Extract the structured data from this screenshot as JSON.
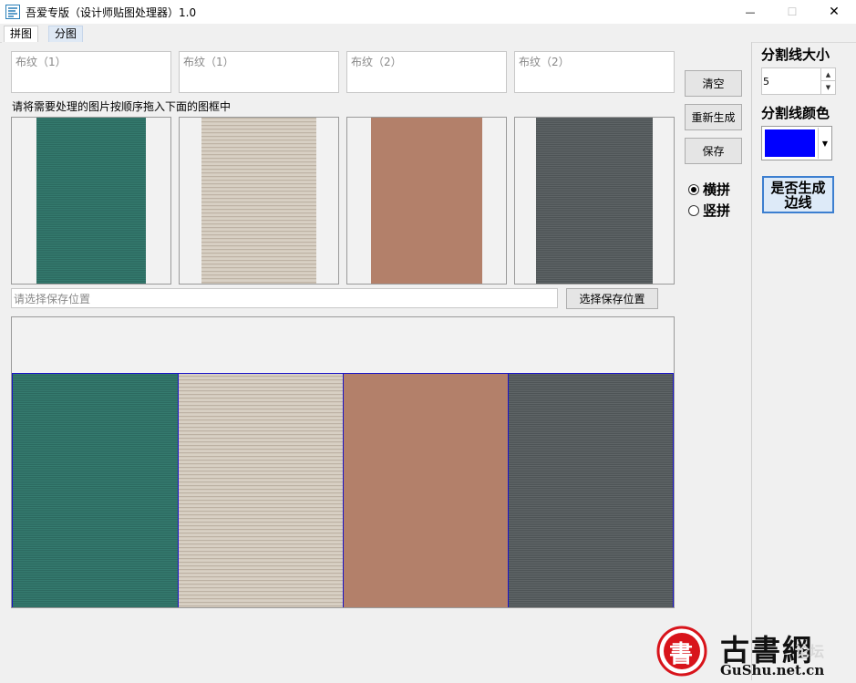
{
  "window": {
    "title": "吾爱专版（设计师贴图处理器）1.0",
    "minimize_glyph": "—",
    "maximize_glyph": "☐",
    "close_glyph": "✕"
  },
  "tabs": [
    {
      "label": "拼图",
      "active": true
    },
    {
      "label": "分图",
      "active": false
    }
  ],
  "name_fields": [
    "布纹（1）",
    "布纹（1）",
    "布纹（2）",
    "布纹（2）"
  ],
  "hint": "请将需要处理的图片按顺序拖入下面的图框中",
  "images": [
    {
      "color": "#2f6e63",
      "name": "teal-fabric"
    },
    {
      "color": "#cfc5b8",
      "name": "beige-fabric"
    },
    {
      "color": "#b48068",
      "name": "terracotta-fabric"
    },
    {
      "color": "#54595b",
      "name": "dark-gray-fabric"
    }
  ],
  "buttons": {
    "clear": "清空",
    "regenerate": "重新生成",
    "save": "保存",
    "choose_location": "选择保存位置"
  },
  "orientation": {
    "horizontal": "横拼",
    "vertical": "竖拼",
    "selected": "horizontal"
  },
  "save_path": {
    "placeholder": "请选择保存位置"
  },
  "side": {
    "divider_size_label": "分割线大小",
    "divider_size_value": "5",
    "divider_color_label": "分割线颜色",
    "divider_color": "#0000ff",
    "gen_edge_line_1": "是否生成",
    "gen_edge_line_2": "边线"
  },
  "watermark": {
    "seal_char": "書",
    "brand": "古書網",
    "url": "GuShu.net.cn",
    "faded": "论坛"
  }
}
